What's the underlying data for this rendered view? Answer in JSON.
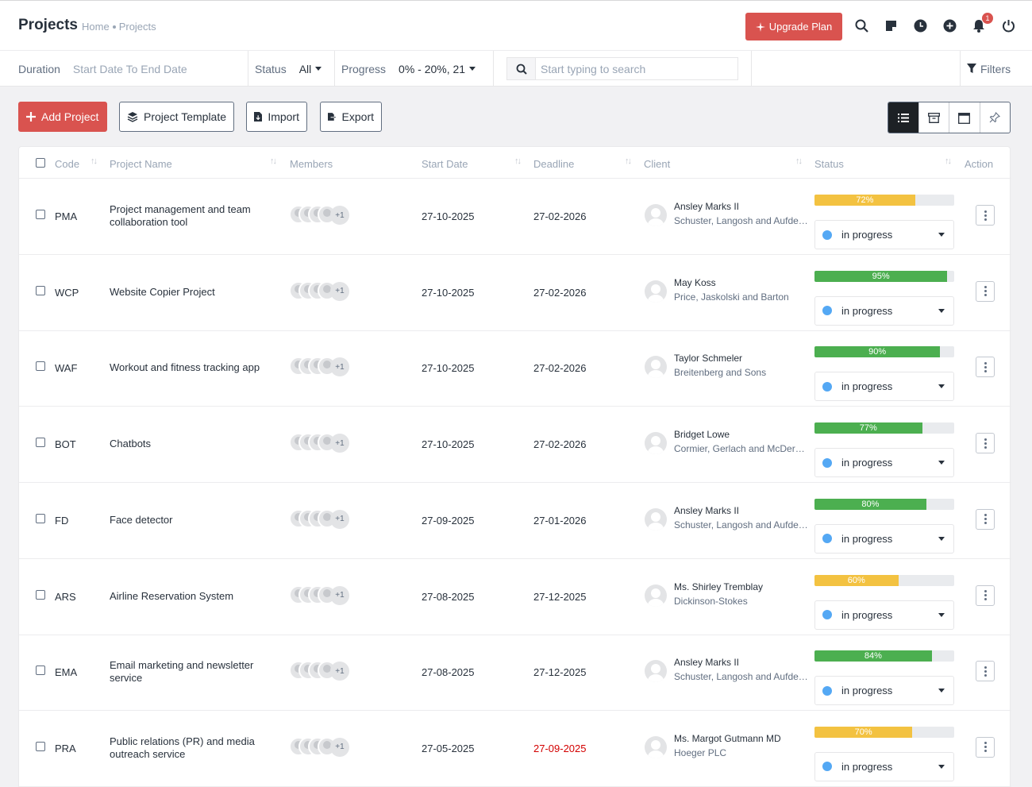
{
  "header": {
    "title": "Projects",
    "breadcrumb": [
      "Home",
      "Projects"
    ],
    "upgrade_label": "Upgrade Plan",
    "notification_count": "1",
    "icons": [
      "search-icon",
      "sticky-note-icon",
      "clock-icon",
      "plus-circle-icon",
      "bell-icon",
      "power-icon"
    ]
  },
  "filters": {
    "duration_label": "Duration",
    "duration_value": "Start Date To End Date",
    "status_label": "Status",
    "status_value": "All",
    "progress_label": "Progress",
    "progress_value": "0% - 20%, 21",
    "search_placeholder": "Start typing to search",
    "filters_label": "Filters"
  },
  "toolbar": {
    "add_label": "Add Project",
    "template_label": "Project Template",
    "import_label": "Import",
    "export_label": "Export"
  },
  "table": {
    "columns": {
      "code": "Code",
      "name": "Project Name",
      "members": "Members",
      "start": "Start Date",
      "deadline": "Deadline",
      "client": "Client",
      "status": "Status",
      "action": "Action"
    },
    "rows": [
      {
        "code": "PMA",
        "name": "Project management and team collaboration tool",
        "members_more": "+1",
        "start": "27-10-2025",
        "deadline": "27-02-2026",
        "client_name": "Ansley Marks II",
        "client_company": "Schuster, Langosh and Aufderhar",
        "progress": 72,
        "progress_label": "72%",
        "status": "in progress"
      },
      {
        "code": "WCP",
        "name": "Website Copier Project",
        "members_more": "+1",
        "start": "27-10-2025",
        "deadline": "27-02-2026",
        "client_name": "May Koss",
        "client_company": "Price, Jaskolski and Barton",
        "progress": 95,
        "progress_label": "95%",
        "status": "in progress"
      },
      {
        "code": "WAF",
        "name": "Workout and fitness tracking app",
        "members_more": "+1",
        "start": "27-10-2025",
        "deadline": "27-02-2026",
        "client_name": "Taylor Schmeler",
        "client_company": "Breitenberg and Sons",
        "progress": 90,
        "progress_label": "90%",
        "status": "in progress"
      },
      {
        "code": "BOT",
        "name": "Chatbots",
        "members_more": "+1",
        "start": "27-10-2025",
        "deadline": "27-02-2026",
        "client_name": "Bridget Lowe",
        "client_company": "Cormier, Gerlach and McDermott",
        "progress": 77,
        "progress_label": "77%",
        "status": "in progress"
      },
      {
        "code": "FD",
        "name": "Face detector",
        "members_more": "+1",
        "start": "27-09-2025",
        "deadline": "27-01-2026",
        "client_name": "Ansley Marks II",
        "client_company": "Schuster, Langosh and Aufderhar",
        "progress": 80,
        "progress_label": "80%",
        "status": "in progress"
      },
      {
        "code": "ARS",
        "name": "Airline Reservation System",
        "members_more": "+1",
        "start": "27-08-2025",
        "deadline": "27-12-2025",
        "client_name": "Ms. Shirley Tremblay",
        "client_company": "Dickinson-Stokes",
        "progress": 60,
        "progress_label": "60%",
        "status": "in progress"
      },
      {
        "code": "EMA",
        "name": "Email marketing and newsletter service",
        "members_more": "+1",
        "start": "27-08-2025",
        "deadline": "27-12-2025",
        "client_name": "Ansley Marks II",
        "client_company": "Schuster, Langosh and Aufderhar",
        "progress": 84,
        "progress_label": "84%",
        "status": "in progress"
      },
      {
        "code": "PRA",
        "name": "Public relations (PR) and media outreach service",
        "members_more": "+1",
        "start": "27-05-2025",
        "deadline": "27-09-2025",
        "client_name": "Ms. Margot Gutmann MD",
        "client_company": "Hoeger PLC",
        "progress": 70,
        "progress_label": "70%",
        "status": "in progress"
      }
    ]
  },
  "colors": {
    "accent": "#d9534f",
    "progress_high": "#4caf50",
    "progress_mid": "#f3c241",
    "status_dot": "#54a8f4",
    "overdue": "#d30000"
  }
}
